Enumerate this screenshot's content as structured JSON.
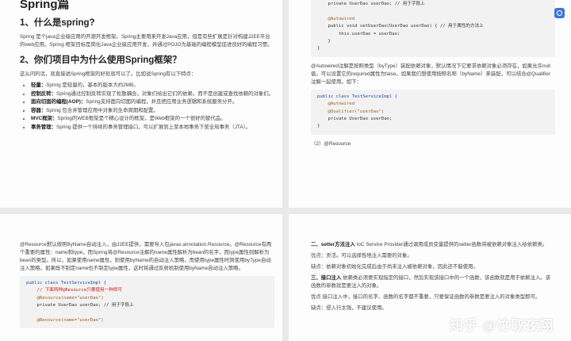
{
  "page1": {
    "title": "Spring篇",
    "h_what": "1、什么是spring?",
    "intro": "Spring 是个java企业级应用的开源开发框架。Spring主要用来开发Java应用，但是有些扩展是针对构建J2EE平台的web应用。Spring 框架目标是简化Java企业级应用开发，并通过POJO为基础的编程模型促进良好的编程习惯。",
    "h_why": "2、你们项目中为什么使用Spring框架？",
    "why_intro": "这么问的话，就直接说Spring框架的好处就可以了。比如说Spring有以下特点：",
    "features": [
      {
        "term": "轻量：",
        "text": "Spring 是轻量的，基本的版本大约2MB。"
      },
      {
        "term": "控制反转：",
        "text": "Spring通过控制反转实现了松散耦合，对象们给出它们的依赖，而不是创建或查找依赖的对象们。"
      },
      {
        "term": "面向切面的编程(AOP)：",
        "text": "Spring支持面向切面的编程，并且把应用业务逻辑和系统服务分开。"
      },
      {
        "term": "容器：",
        "text": "Spring 包含并管理应用中对象的生命周期和配置。"
      },
      {
        "term": "MVC框架：",
        "text": "Spring的WEB框架是个精心设计的框架，是Web框架的一个很好的替代品。"
      },
      {
        "term": "事务管理：",
        "text": "Spring 提供一个持续的事务管理接口，可以扩展到上至本地事务下至全局事务（JTA）。"
      }
    ]
  },
  "page2": {
    "code1": [
      "    private UserDao userDao; // 用于字段上",
      "",
      "    @Autowired",
      "    public void setUserDao(UserDao userDao) { // 用于属性的方法上",
      "        this.userDao = userDao;",
      "    }",
      "}"
    ],
    "autowired_text": "@Autowired注解是按照类型（byType）装配依赖对象，默认情况下它要求依赖对象必须存在，如果允许null值，可以设置它的required属性为false。如果我们想使用按照名称（byName）来装配，可以结合@Qualifier注解一起使用。如下：",
    "code2": [
      "public class TestServiceImpl {",
      "    @Autowired",
      "    @Qualifier(\"userDao\")",
      "    private UserDao userDao;",
      "}"
    ],
    "resource_heading": "（2）@Resource"
  },
  "page3": {
    "resource_text": "@Resource默认按照ByName自动注入，由J2EE提供，需要导入包javax.annotation.Resource。@Resource有两个重要的属性：name和type，而Spring将@Resource注解的name属性解析为bean的名字，而type属性则解析为bean的类型。所以，如果使用name属性，则使用byName的自动注入策略，而使用type属性时则使用byType自动注入策略。如果既不制定name也不制定type属性，这时将通过反射机制使用byName自动注入策略。",
    "code": [
      "public class TestServiceImpl {",
      "    // 下面两种@Resource只要使用一种即可",
      "    @Resource(name=\"userDao\")",
      "    private UserDao userDao; // 用于字段上",
      "",
      "    @Resource(name=\"userDao\")"
    ]
  },
  "page4": {
    "setter_term": "二、setter方法注入",
    "setter_text": " IoC Service Provider通过调用成员变量提供的setter函数将被依赖对象注入给依赖类。",
    "setter_pros": "优点：灵活。可以选择性地注入需要的对象。",
    "setter_cons": "缺点：依赖对象初始化完成后由于尚未注入被依赖对象，因此还不能使用。",
    "iface_term": "三、接口注入",
    "iface_text": " 依赖类必须要实现指定的接口，然后实现该接口中的一个函数，该函数就是用于依赖注入。该函数的参数就是要注入的对象。",
    "iface_pros": "优点 接口注入中，接口的名字、函数的名字都不重要，只要保证函数的参数是要注入的对象类型即可。",
    "iface_cons": "缺点：侵入行太强，不建议使用。"
  },
  "watermark": "知乎 @竹取夜翔"
}
